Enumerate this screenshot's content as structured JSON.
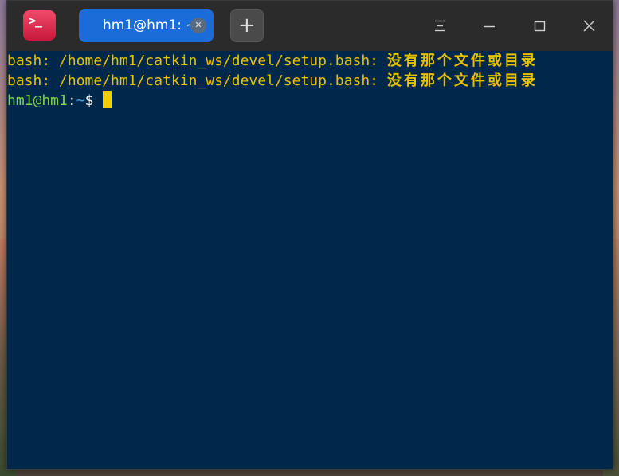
{
  "window": {
    "tab_title": "hm1@hm1: ~",
    "tab_close_icon": "close-icon",
    "new_tab_label": "+",
    "app_icon_glyph": ">_",
    "controls": {
      "menu_icon": "hamburger-icon",
      "minimize_icon": "minimize-icon",
      "maximize_icon": "maximize-icon",
      "close_icon": "close-icon"
    }
  },
  "terminal": {
    "lines": [
      {
        "prefix": "bash: /home/hm1/catkin_ws/devel/setup.bash: ",
        "message": "没有那个文件或目录"
      },
      {
        "prefix": "bash: /home/hm1/catkin_ws/devel/setup.bash: ",
        "message": "没有那个文件或目录"
      }
    ],
    "prompt": {
      "user_host": "hm1@hm1",
      "separator": ":",
      "path": "~",
      "symbol": "$"
    }
  },
  "colors": {
    "terminal_bg": "#00284b",
    "error_text": "#e8c000",
    "prompt_user": "#7ad44a",
    "prompt_path": "#4aa0e0",
    "tab_active": "#1a6cd8",
    "titlebar": "#2b2b2b",
    "cursor": "#f0d000"
  }
}
